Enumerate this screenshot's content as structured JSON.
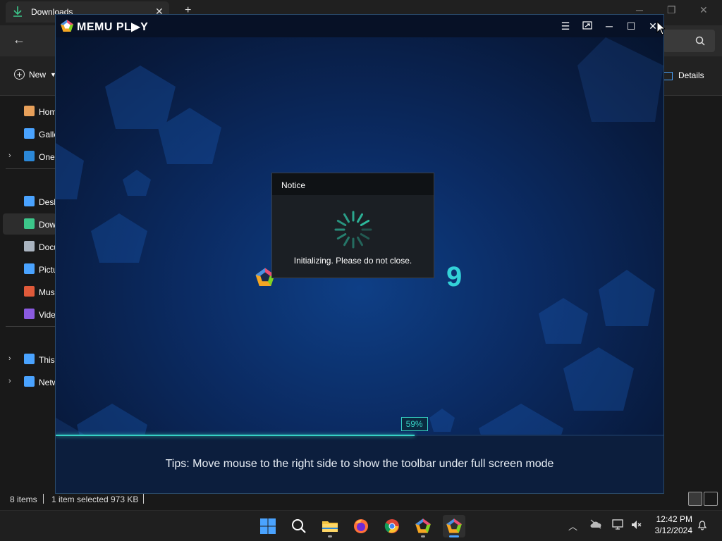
{
  "explorer": {
    "tab_title": "Downloads",
    "new_button": "New",
    "details_button": "Details",
    "nav": [
      {
        "label": "Home",
        "color": "#e8a05a",
        "expand": ""
      },
      {
        "label": "Gallery",
        "color": "#4aa3ff",
        "expand": ""
      },
      {
        "label": "OneDrive",
        "color": "#2b88d8",
        "expand": ">"
      },
      {
        "label": "Desktop",
        "color": "#4aa3ff",
        "expand": ""
      },
      {
        "label": "Downloads",
        "color": "#3cc68a",
        "expand": "",
        "selected": true
      },
      {
        "label": "Documents",
        "color": "#aab4c0",
        "expand": ""
      },
      {
        "label": "Pictures",
        "color": "#4aa3ff",
        "expand": ""
      },
      {
        "label": "Music",
        "color": "#e05a3a",
        "expand": ""
      },
      {
        "label": "Videos",
        "color": "#8a5ae0",
        "expand": ""
      },
      {
        "label": "This PC",
        "color": "#4aa3ff",
        "expand": ">"
      },
      {
        "label": "Network",
        "color": "#4aa3ff",
        "expand": ">"
      }
    ],
    "status": {
      "items": "8 items",
      "selected": "1 item selected",
      "size": "973 KB"
    }
  },
  "memu": {
    "brand": "MEMU PL▶Y",
    "version_digit": "9",
    "progress": {
      "percent": 59,
      "label": "59%"
    },
    "tips": "Tips: Move mouse to the right side to show the toolbar under full screen mode",
    "notice": {
      "title": "Notice",
      "message": "Initializing. Please do not close."
    }
  },
  "taskbar": {
    "apps": [
      "start-icon",
      "search-icon",
      "file-explorer-icon",
      "firefox-icon",
      "chrome-icon",
      "memu-multi-icon",
      "memu-icon"
    ],
    "time": "12:42 PM",
    "date": "3/12/2024"
  },
  "colors": {
    "accent_teal": "#36d1c4",
    "windows_blue": "#4aa3ff"
  }
}
